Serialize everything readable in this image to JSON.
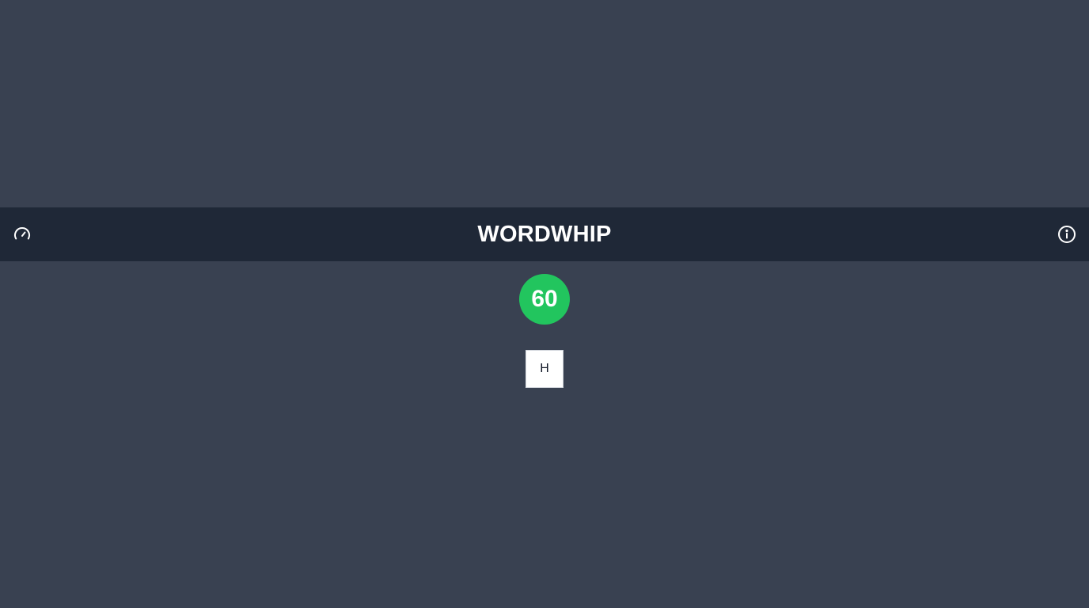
{
  "header": {
    "title": "WORDWHIP",
    "left_icon": "speedometer-icon",
    "right_icon": "info-icon"
  },
  "timer": {
    "value": "60",
    "color": "#22c55e"
  },
  "tiles": [
    {
      "letter": "H"
    }
  ],
  "colors": {
    "background": "#394151",
    "header_background": "#1f2837",
    "text": "#ffffff"
  }
}
